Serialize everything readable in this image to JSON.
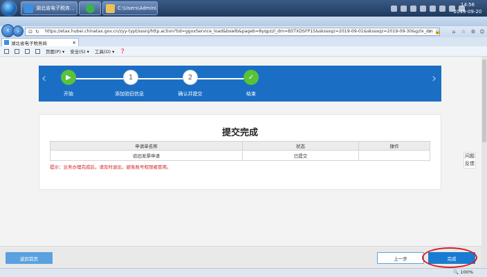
{
  "taskbar": {
    "items": [
      {
        "label": "湖北省电子税务...",
        "icon": "ie-icon"
      },
      {
        "label": "",
        "icon": "green-app-icon"
      },
      {
        "label": "C:\\Users\\Admini...",
        "icon": "folder-icon"
      }
    ],
    "clock_time": "14:56",
    "clock_date": "2019-09-20"
  },
  "browser": {
    "url": "https://etax.hubei.chinatax.gov.cn/zyy-typt/sssnj/http.action?tid=ggxxService_load&bswlb&pageb=8yqpzzl_dm=BSTXDSFP15&sksssqz=2019-09-01&sksssqz=2019-09-30&gzlx_dm",
    "tab_title": "湖北省电子税务局",
    "menu": {
      "page": "页面(P) ▾",
      "safety": "安全(S) ▾",
      "tools": "工具(O) ▾"
    }
  },
  "steps": [
    {
      "label": "开始",
      "mark": "▶",
      "state": "done"
    },
    {
      "label": "添加验旧信息",
      "mark": "1",
      "state": "todo"
    },
    {
      "label": "确认并提交",
      "mark": "2",
      "state": "todo"
    },
    {
      "label": "结束",
      "mark": "✓",
      "state": "done"
    }
  ],
  "main": {
    "title": "提交完成",
    "table": {
      "headers": [
        "申请单名称",
        "状态",
        "操作"
      ],
      "rows": [
        [
          "验旧发票申请",
          "已提交",
          ""
        ]
      ]
    },
    "hint": "提示：业务办理完成后，请及时退出，避免账号权限被冒用。"
  },
  "side": {
    "line1": "问题",
    "line2": "反馈"
  },
  "footer": {
    "home": "返回首页",
    "prev": "上一步",
    "done": "完成"
  },
  "status": {
    "zoom": "100%"
  },
  "colors": {
    "step_bar": "#1a6fc4",
    "done": "#59c23a",
    "hint": "#d02020",
    "highlight_ring": "#d81e1e"
  }
}
